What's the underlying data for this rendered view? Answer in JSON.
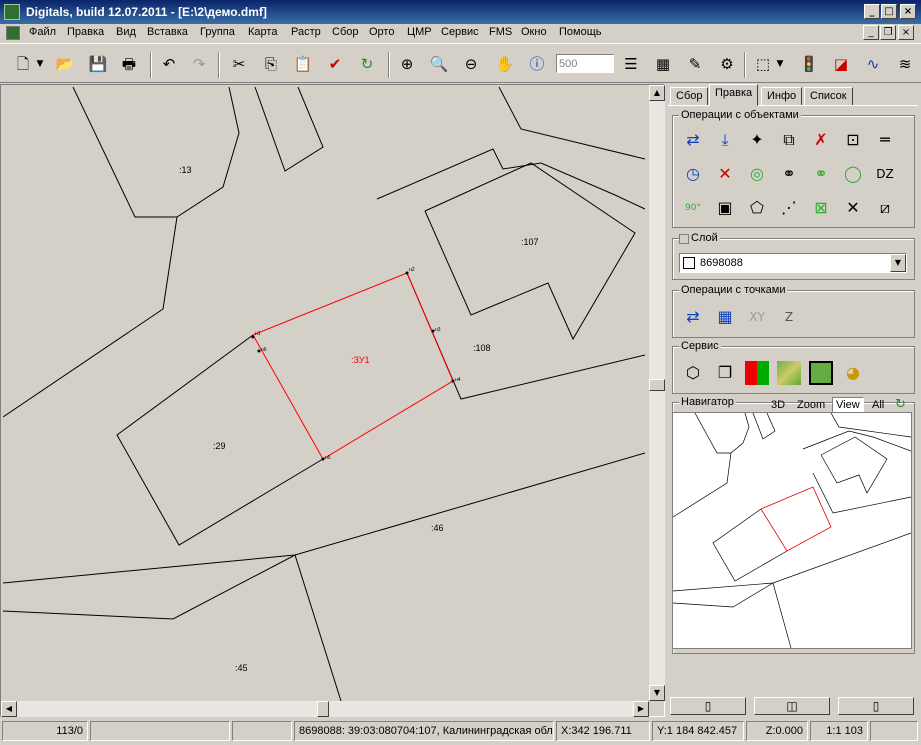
{
  "window": {
    "title": "Digitals, build 12.07.2011 - [E:\\2\\демо.dmf]"
  },
  "menu": [
    "Файл",
    "Правка",
    "Вид",
    "Вставка",
    "Группа",
    "Карта",
    "Растр",
    "Сбор",
    "Орто",
    "ЦМР",
    "Сервис",
    "FMS",
    "Окно",
    "Помощь"
  ],
  "toolbar": {
    "scale_value": "500"
  },
  "map": {
    "labels": {
      "p13": ":13",
      "p107": ":107",
      "p108": ":108",
      "p29": ":29",
      "p46": ":46",
      "p45": ":45",
      "zu1": ":ЗУ1"
    },
    "points": [
      "н1",
      "н2",
      "н3",
      "н4",
      "н5",
      "н6"
    ],
    "colors": {
      "background": "#d4d0c8",
      "lines": "#000000",
      "selected_parcel": "#ff0000"
    }
  },
  "panel": {
    "tabs": [
      "Сбор",
      "Правка",
      "Инфо",
      "Список"
    ],
    "active_tab": "Правка",
    "object_ops_title": "Операции с объектами",
    "layer_title": "Слой",
    "layer_value": "8698088",
    "point_ops_title": "Операции с точками",
    "point_ops_xy": "XY",
    "point_ops_z": "Z",
    "service_title": "Сервис",
    "navigator_title": "Навигатор",
    "nav_modes": [
      "3D",
      "Zoom",
      "View",
      "All"
    ],
    "active_nav_mode": "View"
  },
  "status": {
    "count": "113/0",
    "object_info": "8698088: 39:03:080704:107, Калининградская обл,",
    "x": "X:342 196.711",
    "y": "Y:1 184 842.457",
    "z": "Z:0.000",
    "scale": "1:1 103"
  }
}
